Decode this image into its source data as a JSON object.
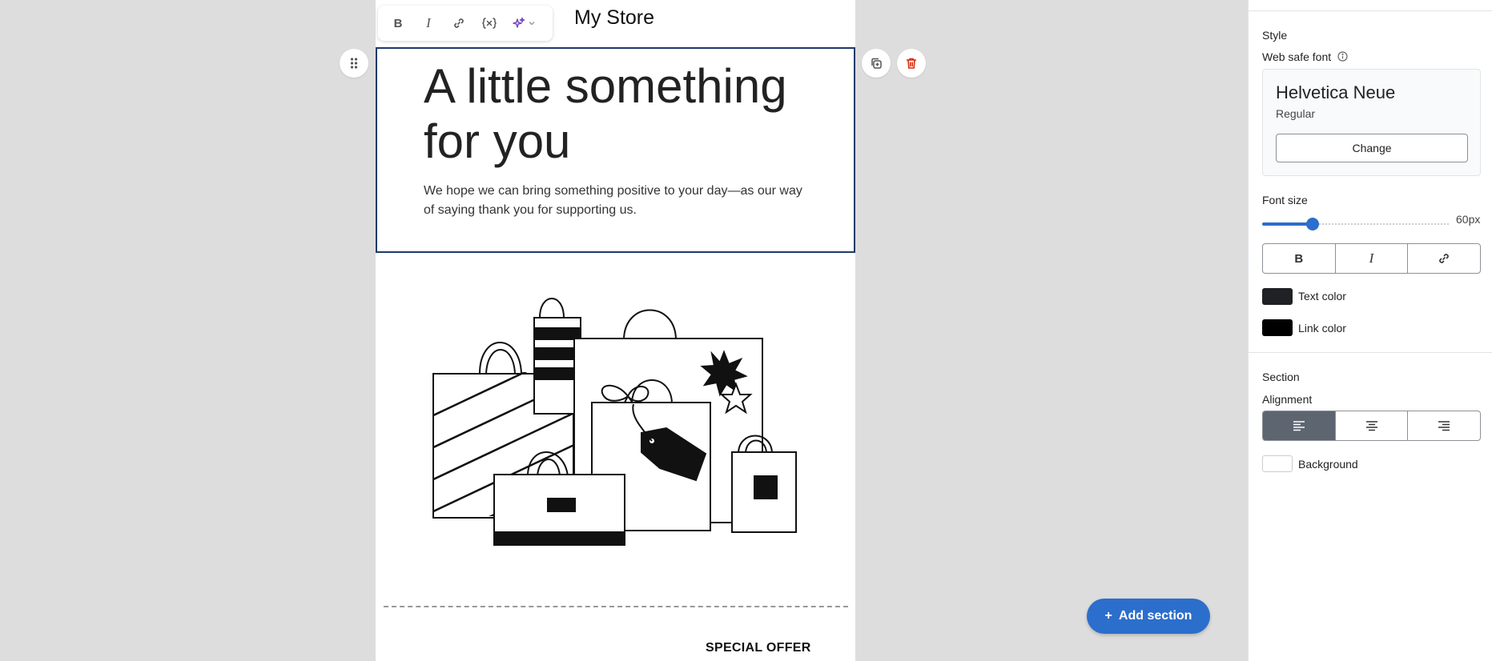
{
  "email": {
    "store_name": "My Store",
    "headline": "A little something for you",
    "subtext": "We hope we can bring something positive to your day—as our way of saying thank you for supporting us.",
    "special_offer": "SPECIAL OFFER"
  },
  "toolbar": {
    "bold_glyph": "B",
    "italic_glyph": "I"
  },
  "add_section": {
    "plus": "+",
    "label": "Add section"
  },
  "panel": {
    "style_heading": "Style",
    "web_safe_font_label": "Web safe font",
    "font_name": "Helvetica Neue",
    "font_weight": "Regular",
    "change_label": "Change",
    "font_size_label": "Font size",
    "font_size_value": "60px",
    "font_size_px": 60,
    "format_bold": "B",
    "format_italic": "I",
    "text_color_label": "Text color",
    "text_color": "#202124",
    "link_color_label": "Link color",
    "link_color": "#000000",
    "section_heading": "Section",
    "alignment_label": "Alignment",
    "alignment_selected": "left",
    "background_label": "Background",
    "background_color": "#ffffff"
  },
  "colors": {
    "accent": "#2c6ecb",
    "selection_border": "#1b3a6b",
    "delete": "#d72c0d"
  }
}
